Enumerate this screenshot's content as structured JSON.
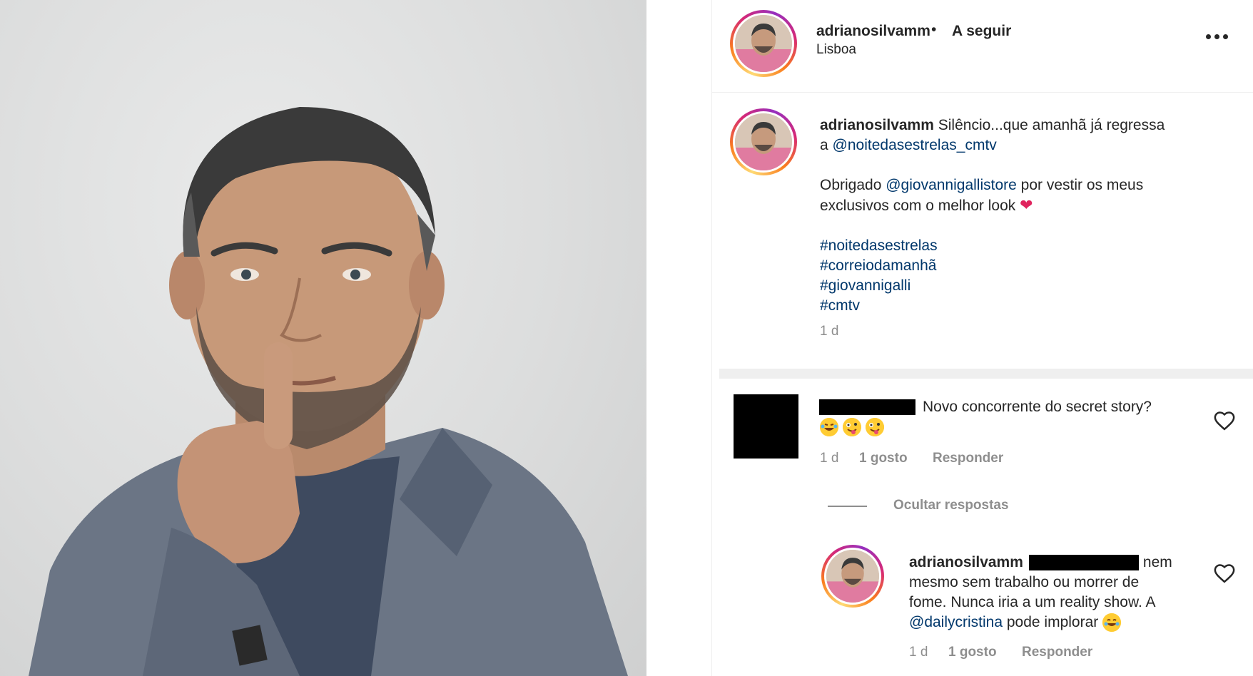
{
  "header": {
    "username": "adrianosilvamm",
    "separator": "•",
    "follow_label": "A seguir",
    "location": "Lisboa"
  },
  "caption": {
    "username": "adrianosilvamm",
    "line1": "Silêncio...que amanhã já regressa",
    "line2_prefix": "a",
    "mention1": "@noitedasestrelas_cmtv",
    "line3_prefix": "Obrigado",
    "mention2": "@giovannigallistore",
    "line3_suffix": "por vestir os meus",
    "line4": "exclusivos com o melhor look",
    "hashtags": [
      "#noitedasestrelas",
      "#correiodamanhã",
      "#giovannigalli",
      "#cmtv"
    ],
    "time": "1 d"
  },
  "comment1": {
    "text": "Novo concorrente do secret story?",
    "time": "1 d",
    "likes": "1 gosto",
    "reply_label": "Responder",
    "hide_replies_label": "Ocultar respostas"
  },
  "reply1": {
    "username": "adrianosilvamm",
    "text_line1": "nem",
    "text_line2": "mesmo sem trabalho ou morrer de",
    "text_line3": "fome. Nunca iria a um reality show. A",
    "mention": "@dailycristina",
    "text_line4_suffix": "pode implorar",
    "time": "1 d",
    "likes": "1 gosto",
    "reply_label": "Responder"
  },
  "colors": {
    "text": "#262626",
    "mention": "#00376b",
    "muted": "#8e8e8e",
    "divider": "#efefef"
  },
  "icons": {
    "more": "more-horizontal-icon",
    "heart": "heart-outline-icon"
  }
}
